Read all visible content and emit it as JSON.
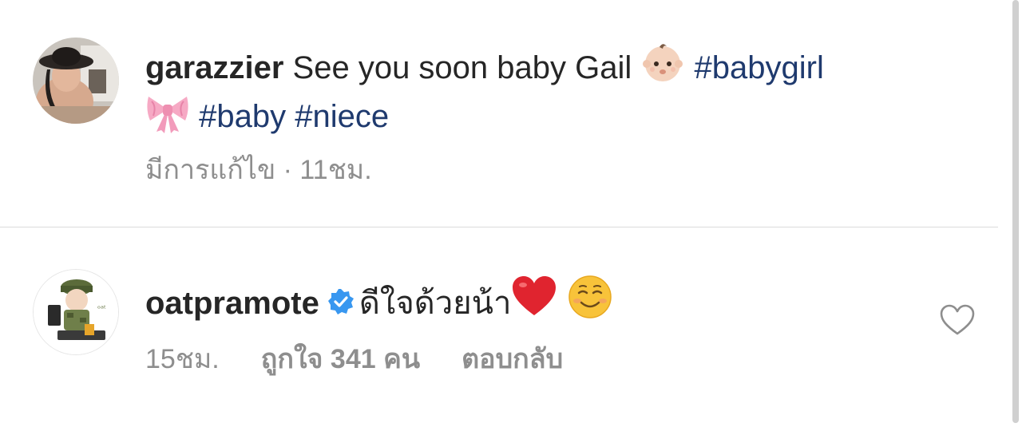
{
  "comments": [
    {
      "username": "garazzier",
      "text_1": " See you soon baby Gail ",
      "hashtag_babygirl": "#babygirl",
      "hashtag_baby": "#baby",
      "hashtag_niece": "#niece",
      "meta_edited": "มีการแก้ไข",
      "meta_sep": " · ",
      "meta_time": "11ชม."
    },
    {
      "username": "oatpramote",
      "text": "ดีใจด้วยน้า",
      "meta_time": "15ชม.",
      "meta_likes": "ถูกใจ 341 คน",
      "meta_reply": "ตอบกลับ"
    }
  ],
  "icons": {
    "baby": "baby-emoji-icon",
    "bow": "ribbon-emoji-icon",
    "heart_red": "red-heart-emoji-icon",
    "smile": "smiling-face-emoji-icon",
    "verified": "verified-badge-icon",
    "like": "heart-outline-icon"
  },
  "colors": {
    "hashtag": "#1f3a6e",
    "meta": "#8e8e8e",
    "verified": "#3897f0",
    "heart": "#e0242f"
  }
}
